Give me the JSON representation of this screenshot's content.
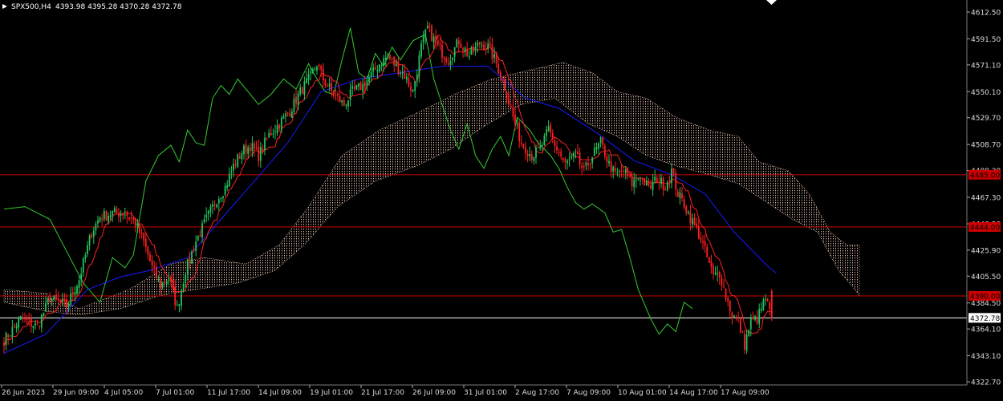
{
  "header": {
    "symbol": "SPX500,H4",
    "ohlc": "4393.98 4395.28 4370.28 4372.78"
  },
  "colors": {
    "background": "#000000",
    "bull": "#22c55e",
    "bear": "#ff1f1f",
    "tenkan": "#ff2020",
    "kijun": "#1a1aff",
    "chikou": "#33cc33",
    "cloud": "#f0c8b4",
    "level": "#cc0000",
    "current": "#ffffff"
  },
  "chart_data": {
    "type": "candlestick",
    "indicator": "Ichimoku",
    "ylim": [
      4322.7,
      4617
    ],
    "y_ticks": [
      "4612.50",
      "4591.50",
      "4571.10",
      "4550.10",
      "4529.70",
      "4508.70",
      "4488.30",
      "4467.30",
      "4446.50",
      "4425.90",
      "4405.50",
      "4384.50",
      "4364.10",
      "4343.10",
      "4322.70"
    ],
    "x_ticks": [
      "26 Jun 2023",
      "29 Jun 09:00",
      "4 Jul 05:00",
      "7 Jul 01:00",
      "11 Jul 17:00",
      "14 Jul 09:00",
      "19 Jul 01:00",
      "21 Jul 17:00",
      "26 Jul 09:00",
      "31 Jul 01:00",
      "2 Aug 17:00",
      "7 Aug 09:00",
      "10 Aug 01:00",
      "14 Aug 17:00",
      "17 Aug 09:00"
    ],
    "levels": [
      {
        "value": 4485.0,
        "label": "4485.00"
      },
      {
        "value": 4444.0,
        "label": "4444.00"
      },
      {
        "value": 4390.0,
        "label": "4390.00"
      }
    ],
    "current_price": {
      "value": 4372.78,
      "label": "4372.78"
    },
    "close_path": [
      [
        0,
        4355
      ],
      [
        8,
        4372
      ],
      [
        16,
        4366
      ],
      [
        22,
        4388
      ],
      [
        30,
        4382
      ],
      [
        36,
        4403
      ],
      [
        42,
        4440
      ],
      [
        46,
        4452
      ],
      [
        52,
        4455
      ],
      [
        58,
        4455
      ],
      [
        63,
        4447
      ],
      [
        67,
        4432
      ],
      [
        71,
        4412
      ],
      [
        75,
        4398
      ],
      [
        79,
        4405
      ],
      [
        83,
        4380
      ],
      [
        87,
        4410
      ],
      [
        92,
        4433
      ],
      [
        97,
        4450
      ],
      [
        102,
        4466
      ],
      [
        106,
        4475
      ],
      [
        110,
        4492
      ],
      [
        114,
        4503
      ],
      [
        118,
        4508
      ],
      [
        122,
        4500
      ],
      [
        127,
        4516
      ],
      [
        132,
        4525
      ],
      [
        137,
        4535
      ],
      [
        142,
        4550
      ],
      [
        147,
        4562
      ],
      [
        150,
        4572
      ],
      [
        153,
        4560
      ],
      [
        158,
        4548
      ],
      [
        163,
        4540
      ],
      [
        167,
        4550
      ],
      [
        172,
        4555
      ],
      [
        176,
        4563
      ],
      [
        180,
        4572
      ],
      [
        184,
        4578
      ],
      [
        188,
        4570
      ],
      [
        192,
        4563
      ],
      [
        196,
        4550
      ],
      [
        200,
        4585
      ],
      [
        203,
        4600
      ],
      [
        208,
        4585
      ],
      [
        213,
        4575
      ],
      [
        218,
        4590
      ],
      [
        223,
        4578
      ],
      [
        228,
        4588
      ],
      [
        232,
        4585
      ],
      [
        235,
        4576
      ],
      [
        239,
        4560
      ],
      [
        244,
        4530
      ],
      [
        248,
        4510
      ],
      [
        253,
        4500
      ],
      [
        257,
        4505
      ],
      [
        261,
        4520
      ],
      [
        265,
        4505
      ],
      [
        269,
        4493
      ],
      [
        274,
        4500
      ],
      [
        278,
        4487
      ],
      [
        282,
        4500
      ],
      [
        286,
        4510
      ],
      [
        290,
        4493
      ],
      [
        293,
        4485
      ],
      [
        297,
        4488
      ],
      [
        301,
        4478
      ],
      [
        305,
        4484
      ],
      [
        309,
        4474
      ],
      [
        313,
        4482
      ],
      [
        317,
        4476
      ],
      [
        320,
        4488
      ],
      [
        323,
        4470
      ],
      [
        326,
        4462
      ],
      [
        330,
        4448
      ],
      [
        334,
        4435
      ],
      [
        337,
        4420
      ],
      [
        340,
        4405
      ],
      [
        343,
        4408
      ],
      [
        346,
        4390
      ],
      [
        349,
        4375
      ],
      [
        352,
        4370
      ],
      [
        355,
        4352
      ],
      [
        358,
        4370
      ],
      [
        361,
        4372
      ],
      [
        365,
        4388
      ],
      [
        368,
        4372
      ]
    ],
    "kijun_path": [
      [
        0,
        4345
      ],
      [
        20,
        4360
      ],
      [
        40,
        4395
      ],
      [
        56,
        4405
      ],
      [
        70,
        4410
      ],
      [
        88,
        4420
      ],
      [
        104,
        4450
      ],
      [
        120,
        4480
      ],
      [
        136,
        4510
      ],
      [
        152,
        4550
      ],
      [
        170,
        4560
      ],
      [
        190,
        4565
      ],
      [
        210,
        4570
      ],
      [
        232,
        4570
      ],
      [
        250,
        4545
      ],
      [
        266,
        4537
      ],
      [
        284,
        4518
      ],
      [
        302,
        4496
      ],
      [
        320,
        4485
      ],
      [
        336,
        4470
      ],
      [
        350,
        4440
      ],
      [
        365,
        4415
      ],
      [
        370,
        4408
      ]
    ],
    "chikou_path": [
      [
        0,
        4458
      ],
      [
        10,
        4460
      ],
      [
        22,
        4450
      ],
      [
        30,
        4425
      ],
      [
        38,
        4400
      ],
      [
        46,
        4385
      ],
      [
        52,
        4420
      ],
      [
        58,
        4412
      ],
      [
        62,
        4422
      ],
      [
        68,
        4480
      ],
      [
        74,
        4500
      ],
      [
        80,
        4508
      ],
      [
        84,
        4495
      ],
      [
        88,
        4520
      ],
      [
        92,
        4510
      ],
      [
        96,
        4508
      ],
      [
        100,
        4545
      ],
      [
        104,
        4555
      ],
      [
        108,
        4548
      ],
      [
        112,
        4560
      ],
      [
        116,
        4552
      ],
      [
        122,
        4540
      ],
      [
        128,
        4548
      ],
      [
        134,
        4560
      ],
      [
        140,
        4552
      ],
      [
        146,
        4572
      ],
      [
        150,
        4560
      ],
      [
        154,
        4550
      ],
      [
        158,
        4548
      ],
      [
        162,
        4575
      ],
      [
        166,
        4600
      ],
      [
        170,
        4565
      ],
      [
        174,
        4560
      ],
      [
        178,
        4580
      ],
      [
        182,
        4570
      ],
      [
        186,
        4585
      ],
      [
        190,
        4575
      ],
      [
        196,
        4590
      ],
      [
        202,
        4595
      ],
      [
        206,
        4560
      ],
      [
        210,
        4540
      ],
      [
        214,
        4520
      ],
      [
        218,
        4505
      ],
      [
        222,
        4525
      ],
      [
        226,
        4500
      ],
      [
        230,
        4490
      ],
      [
        234,
        4505
      ],
      [
        238,
        4515
      ],
      [
        242,
        4500
      ],
      [
        246,
        4530
      ],
      [
        252,
        4520
      ],
      [
        256,
        4510
      ],
      [
        262,
        4500
      ],
      [
        266,
        4490
      ],
      [
        270,
        4475
      ],
      [
        274,
        4463
      ],
      [
        278,
        4458
      ],
      [
        282,
        4462
      ],
      [
        288,
        4455
      ],
      [
        292,
        4440
      ],
      [
        296,
        4442
      ],
      [
        300,
        4420
      ],
      [
        304,
        4395
      ],
      [
        310,
        4372
      ],
      [
        314,
        4360
      ],
      [
        318,
        4368
      ],
      [
        322,
        4362
      ],
      [
        326,
        4385
      ],
      [
        330,
        4380
      ]
    ],
    "cloud_upper": [
      [
        0,
        4395
      ],
      [
        20,
        4392
      ],
      [
        36,
        4380
      ],
      [
        60,
        4395
      ],
      [
        80,
        4415
      ],
      [
        96,
        4420
      ],
      [
        116,
        4415
      ],
      [
        132,
        4430
      ],
      [
        146,
        4460
      ],
      [
        162,
        4500
      ],
      [
        180,
        4520
      ],
      [
        200,
        4535
      ],
      [
        216,
        4548
      ],
      [
        234,
        4560
      ],
      [
        252,
        4567
      ],
      [
        268,
        4573
      ],
      [
        282,
        4565
      ],
      [
        294,
        4550
      ],
      [
        308,
        4545
      ],
      [
        322,
        4530
      ],
      [
        338,
        4520
      ],
      [
        352,
        4515
      ],
      [
        362,
        4495
      ],
      [
        376,
        4488
      ],
      [
        386,
        4470
      ],
      [
        396,
        4440
      ],
      [
        404,
        4430
      ],
      [
        410,
        4430
      ]
    ],
    "cloud_lower": [
      [
        0,
        4385
      ],
      [
        20,
        4378
      ],
      [
        36,
        4375
      ],
      [
        56,
        4380
      ],
      [
        74,
        4390
      ],
      [
        92,
        4395
      ],
      [
        112,
        4400
      ],
      [
        130,
        4410
      ],
      [
        144,
        4430
      ],
      [
        160,
        4460
      ],
      [
        178,
        4480
      ],
      [
        198,
        4492
      ],
      [
        214,
        4505
      ],
      [
        232,
        4525
      ],
      [
        248,
        4540
      ],
      [
        264,
        4545
      ],
      [
        280,
        4525
      ],
      [
        294,
        4515
      ],
      [
        308,
        4500
      ],
      [
        322,
        4492
      ],
      [
        338,
        4485
      ],
      [
        352,
        4478
      ],
      [
        364,
        4465
      ],
      [
        378,
        4450
      ],
      [
        390,
        4440
      ],
      [
        400,
        4410
      ],
      [
        408,
        4395
      ],
      [
        410,
        4390
      ]
    ]
  }
}
